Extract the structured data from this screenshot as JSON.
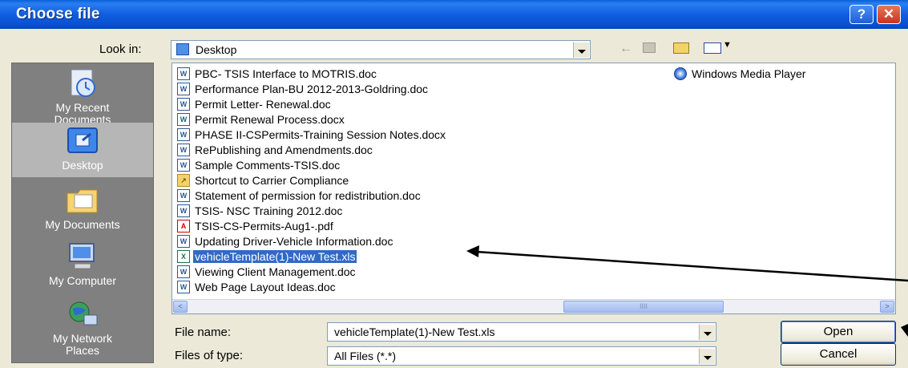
{
  "window": {
    "title": "Choose file"
  },
  "titlebar": {
    "help_label": "?",
    "close_label": "✕"
  },
  "lookin": {
    "label": "Look in:",
    "value": "Desktop"
  },
  "places": [
    {
      "label_1": "My Recent",
      "label_2": "Documents"
    },
    {
      "label_1": "Desktop",
      "label_2": ""
    },
    {
      "label_1": "My Documents",
      "label_2": ""
    },
    {
      "label_1": "My Computer",
      "label_2": ""
    },
    {
      "label_1": "My Network",
      "label_2": "Places"
    }
  ],
  "files": [
    {
      "name": "PBC- TSIS Interface to MOTRIS.doc",
      "icon": "word-doc-icon"
    },
    {
      "name": "Performance Plan-BU 2012-2013-Goldring.doc",
      "icon": "word-doc-icon"
    },
    {
      "name": "Permit Letter- Renewal.doc",
      "icon": "word-doc-icon"
    },
    {
      "name": "Permit Renewal Process.docx",
      "icon": "word-doc-icon"
    },
    {
      "name": "PHASE II-CSPermits-Training Session Notes.docx",
      "icon": "word-doc-icon"
    },
    {
      "name": "RePublishing and Amendments.doc",
      "icon": "word-doc-icon"
    },
    {
      "name": "Sample Comments-TSIS.doc",
      "icon": "word-doc-icon"
    },
    {
      "name": "Shortcut to Carrier Compliance",
      "icon": "folder-shortcut-icon"
    },
    {
      "name": "Statement of permission for redistribution.doc",
      "icon": "word-doc-icon"
    },
    {
      "name": "TSIS- NSC Training 2012.doc",
      "icon": "word-doc-icon"
    },
    {
      "name": "TSIS-CS-Permits-Aug1-.pdf",
      "icon": "pdf-icon"
    },
    {
      "name": "Updating Driver-Vehicle Information.doc",
      "icon": "word-doc-icon"
    },
    {
      "name": "vehicleTemplate(1)-New Test.xls",
      "icon": "excel-icon",
      "selected": true
    },
    {
      "name": "Viewing Client Management.doc",
      "icon": "word-doc-icon"
    },
    {
      "name": "Web Page Layout Ideas.doc",
      "icon": "word-doc-icon"
    }
  ],
  "files_col2": [
    {
      "name": "Windows Media Player",
      "icon": "windows-media-player-icon"
    }
  ],
  "filename": {
    "label": "File name:",
    "value": "vehicleTemplate(1)-New Test.xls"
  },
  "filetype": {
    "label": "Files of type:",
    "value": "All Files (*.*)"
  },
  "buttons": {
    "open": "Open",
    "cancel": "Cancel"
  },
  "scrollbar": {
    "left": "<",
    "right": ">",
    "grip": "IIII"
  }
}
